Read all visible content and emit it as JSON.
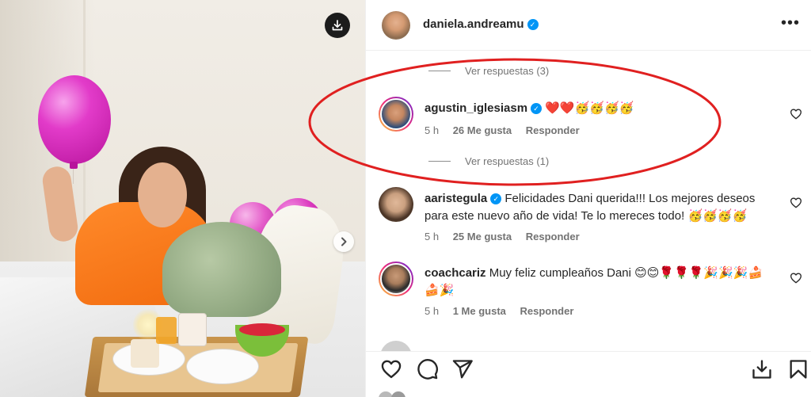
{
  "post": {
    "username": "daniela.andreamu",
    "verified": true
  },
  "photo": {
    "download_icon": "download-icon",
    "next_icon": "chevron-right-icon"
  },
  "replies_top": {
    "label": "Ver respuestas (3)"
  },
  "comments": [
    {
      "username": "agustin_iglesiasm",
      "verified": true,
      "text": "❤️❤️🥳🥳🥳🥳",
      "time": "5 h",
      "likes": "26 Me gusta",
      "reply": "Responder",
      "view_replies": "Ver respuestas (1)"
    },
    {
      "username": "aaristegula",
      "verified": true,
      "text": "Felicidades Dani querida!!! Los mejores deseos para este nuevo año de vida! Te lo mereces todo! 🥳🥳🥳🥳",
      "time": "5 h",
      "likes": "25 Me gusta",
      "reply": "Responder"
    },
    {
      "username": "coachcariz",
      "verified": false,
      "text": "Muy feliz cumpleaños Dani 😊😊🌹🌹🌹🎉🎉🎉🍰🍰🎉",
      "time": "5 h",
      "likes": "1 Me gusta",
      "reply": "Responder"
    }
  ],
  "actions": {
    "like_icon": "heart-icon",
    "comment_icon": "comment-icon",
    "share_icon": "share-icon",
    "download_icon": "download-tray-icon",
    "save_icon": "bookmark-icon"
  },
  "colors": {
    "verified": "#0095f6",
    "annotation": "#e02020",
    "text": "#262626",
    "muted": "#737373"
  }
}
